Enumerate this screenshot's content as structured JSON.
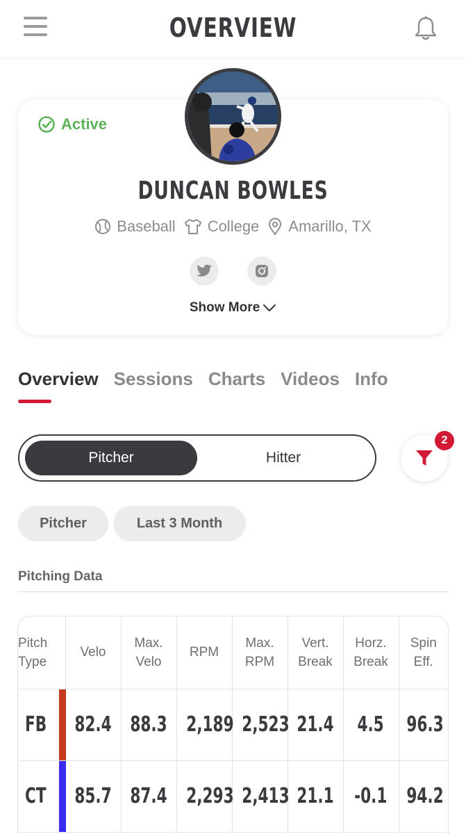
{
  "header": {
    "title": "OVERVIEW",
    "menu_icon": "hamburger-menu-icon",
    "bell_icon": "bell-icon"
  },
  "profile": {
    "status": "Active",
    "name": "DUNCAN BOWLES",
    "sport": "Baseball",
    "level": "College",
    "location": "Amarillo, TX",
    "social": [
      "twitter-icon",
      "instagram-icon"
    ],
    "show_more": "Show More"
  },
  "tabs": [
    {
      "label": "Overview",
      "active": true
    },
    {
      "label": "Sessions",
      "active": false
    },
    {
      "label": "Charts",
      "active": false
    },
    {
      "label": "Videos",
      "active": false
    },
    {
      "label": "Info",
      "active": false
    }
  ],
  "role_toggle": {
    "options": [
      "Pitcher",
      "Hitter"
    ],
    "selected": "Pitcher"
  },
  "filter": {
    "badge_count": "2"
  },
  "chips": [
    "Pitcher",
    "Last 3 Month"
  ],
  "pitching": {
    "section_title": "Pitching Data",
    "columns": [
      [
        "Pitch",
        "Type"
      ],
      [
        "Velo"
      ],
      [
        "Max.",
        "Velo"
      ],
      [
        "RPM"
      ],
      [
        "Max.",
        "RPM"
      ],
      [
        "Vert.",
        "Break"
      ],
      [
        "Horz.",
        "Break"
      ],
      [
        "Spin",
        "Eff."
      ]
    ],
    "rows": [
      {
        "type": "FB",
        "color": "#c83a1e",
        "values": [
          "82.4",
          "88.3",
          "2,189",
          "2,523",
          "21.4",
          "4.5",
          "96.3"
        ]
      },
      {
        "type": "CT",
        "color": "#3a2bf0",
        "values": [
          "85.7",
          "87.4",
          "2,293",
          "2,413",
          "21.1",
          "-0.1",
          "94.2"
        ]
      }
    ]
  },
  "colors": {
    "accent": "#d21a36",
    "active_green": "#5cb35a",
    "dark": "#3a3b3f"
  }
}
